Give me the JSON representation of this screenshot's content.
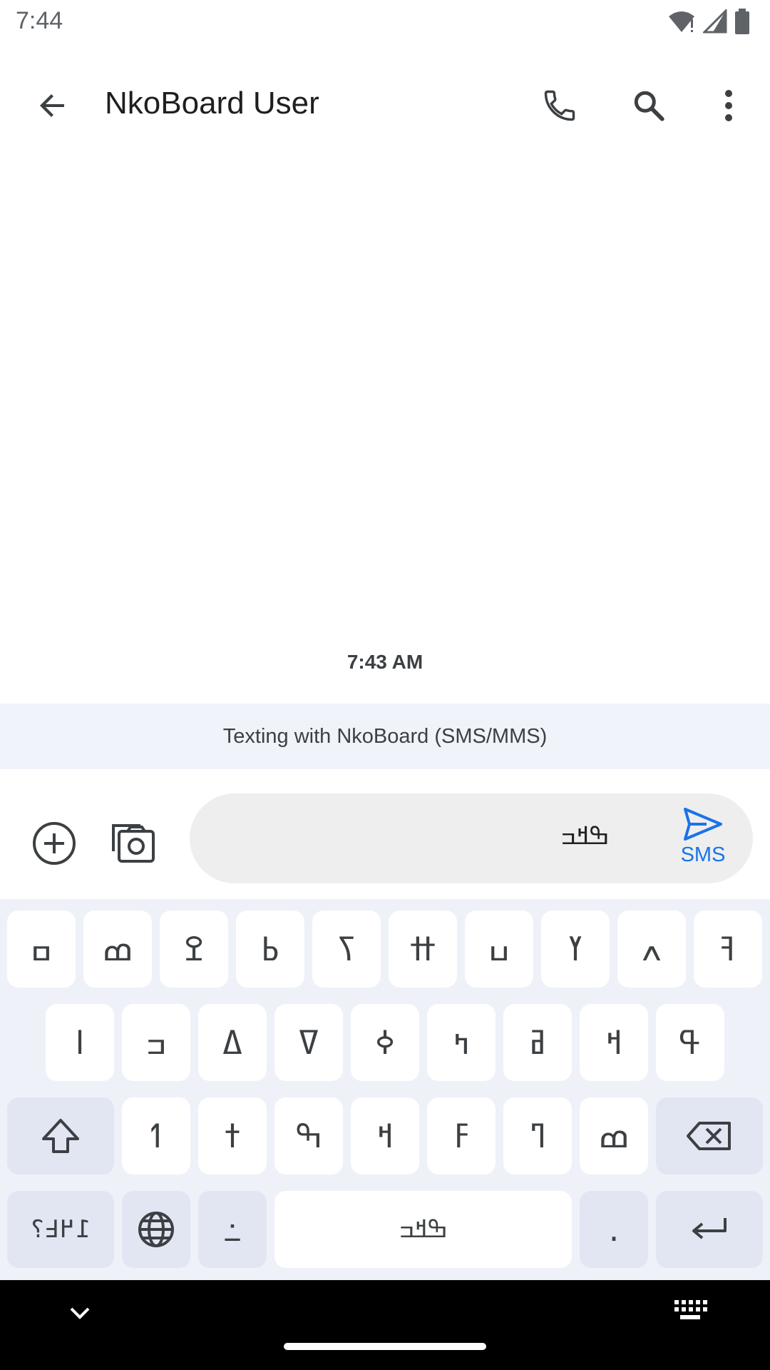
{
  "status": {
    "time": "7:44"
  },
  "app_bar": {
    "contact_name": "NkoBoard User"
  },
  "conversation": {
    "timestamp": "7:43 AM",
    "banner": "Texting with NkoBoard (SMS/MMS)"
  },
  "compose": {
    "text": "ߒߞߏ",
    "send_label": "SMS"
  },
  "keyboard": {
    "row1": [
      "ߛ",
      "ߘ",
      "ߐ",
      "ߕ",
      "ߖ",
      "ߚ",
      "ߎ",
      "ߌ",
      "ߍ",
      "ߔ"
    ],
    "row2": [
      "ߊ",
      "ߏ",
      "ߡ",
      "ߜ",
      "ߦ",
      "ߤ",
      "ߥ",
      "ߞ",
      "ߟ"
    ],
    "row3": [
      "ߗ",
      "ߙ",
      "ߒ",
      "ߞ",
      "ߓ",
      "ߣ",
      "ߘ"
    ],
    "symbols_label": "߁߂߃؟",
    "colon_label": "߸",
    "space_label": "ߒߞߏ",
    "period_label": "."
  },
  "colors": {
    "accent": "#1a73e8",
    "banner_bg": "#f1f3fb",
    "keyboard_bg": "#eff1f9"
  }
}
